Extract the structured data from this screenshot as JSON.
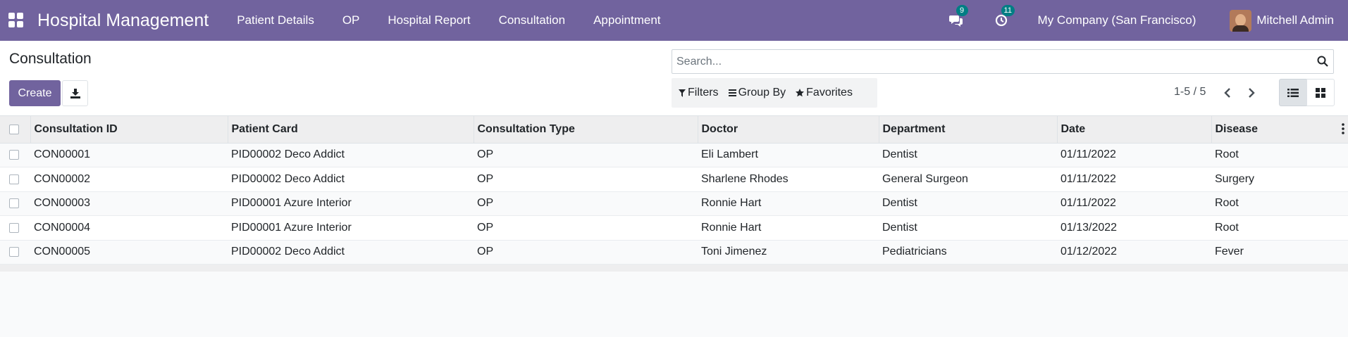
{
  "navbar": {
    "brand": "Hospital Management",
    "menu": [
      {
        "label": "Patient Details"
      },
      {
        "label": "OP"
      },
      {
        "label": "Hospital Report"
      },
      {
        "label": "Consultation"
      },
      {
        "label": "Appointment"
      }
    ],
    "messages_badge": "9",
    "activities_badge": "11",
    "company": "My Company (San Francisco)",
    "user": "Mitchell Admin",
    "color": "#71639e",
    "badge_color": "#017e84"
  },
  "control_panel": {
    "title": "Consultation",
    "create_label": "Create",
    "search_placeholder": "Search...",
    "filters_label": "Filters",
    "group_by_label": "Group By",
    "favorites_label": "Favorites",
    "pager": "1-5 / 5",
    "active_view": "list"
  },
  "table": {
    "columns": [
      "Consultation ID",
      "Patient Card",
      "Consultation Type",
      "Doctor",
      "Department",
      "Date",
      "Disease"
    ],
    "rows": [
      [
        "CON00001",
        "PID00002 Deco Addict",
        "OP",
        "Eli Lambert",
        "Dentist",
        "01/11/2022",
        "Root"
      ],
      [
        "CON00002",
        "PID00002 Deco Addict",
        "OP",
        "Sharlene Rhodes",
        "General Surgeon",
        "01/11/2022",
        "Surgery"
      ],
      [
        "CON00003",
        "PID00001 Azure Interior",
        "OP",
        "Ronnie Hart",
        "Dentist",
        "01/11/2022",
        "Root"
      ],
      [
        "CON00004",
        "PID00001 Azure Interior",
        "OP",
        "Ronnie Hart",
        "Dentist",
        "01/13/2022",
        "Root"
      ],
      [
        "CON00005",
        "PID00002 Deco Addict",
        "OP",
        "Toni Jimenez",
        "Pediatricians",
        "01/12/2022",
        "Fever"
      ]
    ]
  }
}
